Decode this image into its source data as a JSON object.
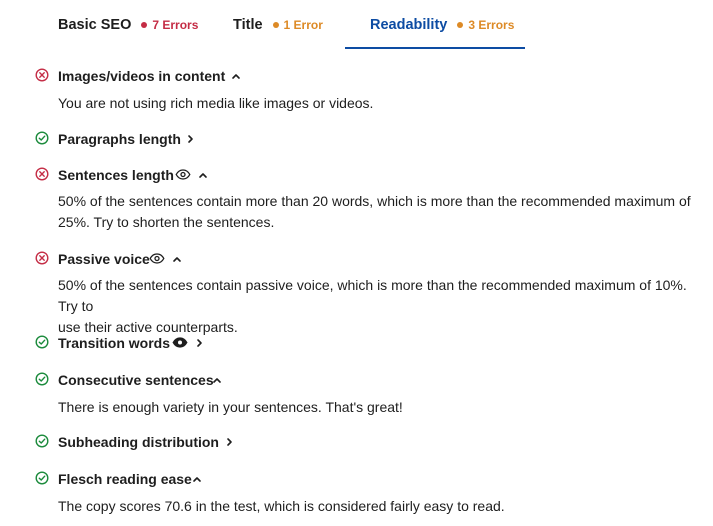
{
  "tabs": [
    {
      "label": "Basic SEO",
      "count": "7 Errors",
      "dot_color": "#c42c45",
      "count_color": "#c42c45"
    },
    {
      "label": "Title",
      "count": "1 Error",
      "dot_color": "#dd8a26",
      "count_color": "#dd8a26"
    },
    {
      "label": "Readability",
      "count": "3 Errors",
      "dot_color": "#dd8a26",
      "count_color": "#dd8a26",
      "active": true
    }
  ],
  "colors": {
    "error": "#c42c45",
    "good": "#1a8a3b",
    "active_tab": "#0d4ca3"
  },
  "checks": [
    {
      "title": "Images/videos in content",
      "status": "error",
      "expanded": true,
      "has_eye": false,
      "description": "You are not using rich media like images or videos."
    },
    {
      "title": "Paragraphs length",
      "status": "good",
      "expanded": false,
      "has_eye": false
    },
    {
      "title": "Sentences length",
      "status": "error",
      "expanded": true,
      "has_eye": true,
      "description_line1": "50% of the sentences contain more than 20 words, which is more than the recommended maximum of",
      "description_line2": "25%. Try to shorten the sentences."
    },
    {
      "title": "Passive voice",
      "status": "error",
      "expanded": true,
      "has_eye": true,
      "description_line1": "50% of the sentences contain passive voice, which is more than the recommended maximum of 10%. Try to",
      "description_line2": "use their active counterparts."
    },
    {
      "title": "Transition words",
      "status": "good",
      "expanded": false,
      "has_eye": true,
      "eye_filled": true
    },
    {
      "title": "Consecutive sentences",
      "status": "good",
      "expanded": true,
      "has_eye": false,
      "description": "There is enough variety in your sentences. That's great!"
    },
    {
      "title": "Subheading distribution",
      "status": "good",
      "expanded": false,
      "has_eye": false
    },
    {
      "title": "Flesch reading ease",
      "status": "good",
      "expanded": true,
      "has_eye": false,
      "description": "The copy scores 70.6 in the test, which is considered fairly easy to read."
    }
  ]
}
